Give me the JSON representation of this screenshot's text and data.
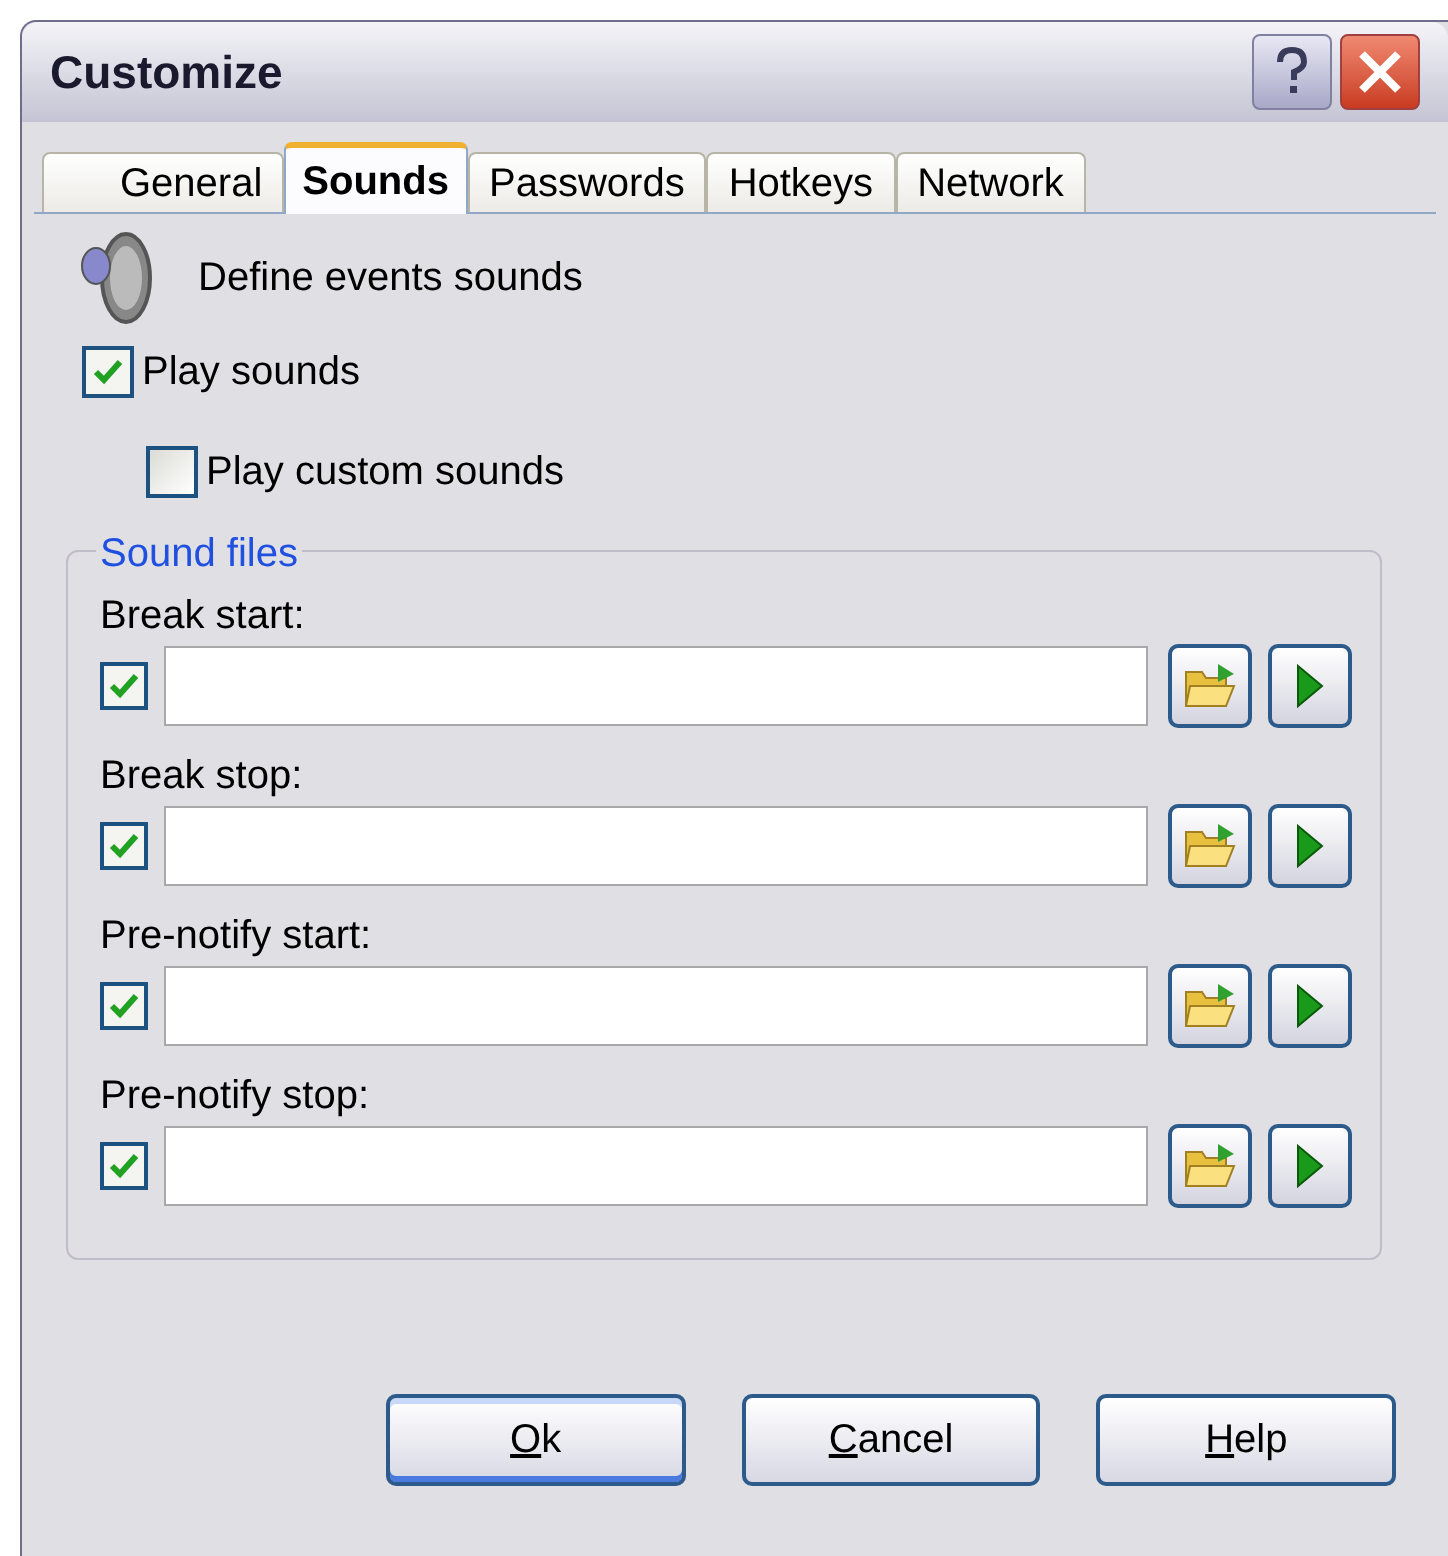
{
  "window": {
    "title": "Customize"
  },
  "tabs": [
    {
      "label": "General",
      "selected": false
    },
    {
      "label": "Sounds",
      "selected": true
    },
    {
      "label": "Passwords",
      "selected": false
    },
    {
      "label": "Hotkeys",
      "selected": false
    },
    {
      "label": "Network",
      "selected": false
    }
  ],
  "header": {
    "text": "Define events sounds"
  },
  "options": [
    {
      "label": "Play sounds",
      "checked": true
    },
    {
      "label": "Play custom sounds",
      "checked": false
    }
  ],
  "sound_files": {
    "title": "Sound files",
    "rows": [
      {
        "label": "Break start:",
        "checked": true
      },
      {
        "label": "Break stop:",
        "checked": true
      },
      {
        "label": "Pre-notify start:",
        "checked": true
      },
      {
        "label": "Pre-notify stop:",
        "checked": true
      }
    ]
  },
  "buttons": [
    {
      "access_key": "O",
      "rest": "k",
      "default": true
    },
    {
      "access_key": "C",
      "rest": "ancel",
      "default": false
    },
    {
      "access_key": "H",
      "rest": "elp",
      "default": false
    }
  ]
}
